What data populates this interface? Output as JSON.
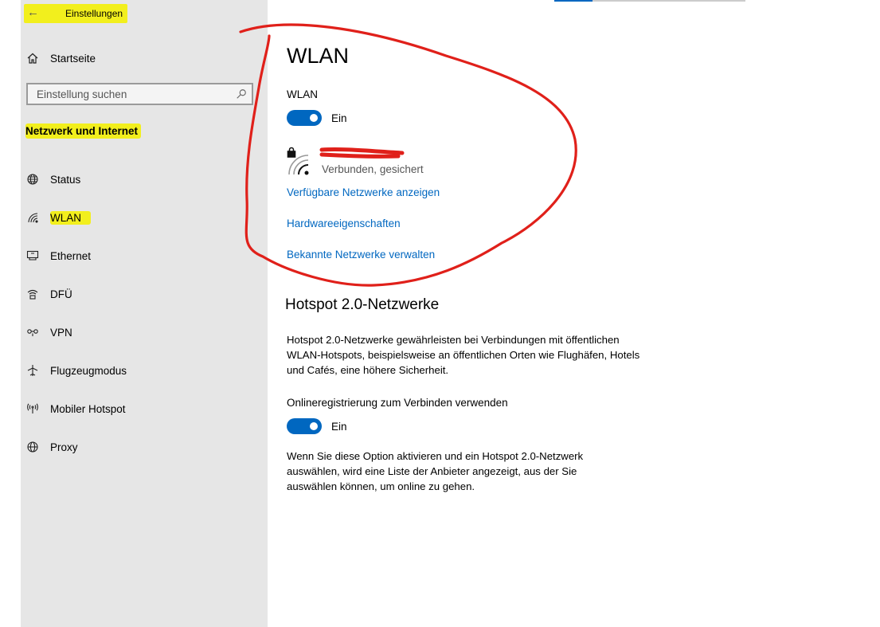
{
  "sidebar": {
    "back_title": "Einstellungen",
    "home_label": "Startseite",
    "search_placeholder": "Einstellung suchen",
    "section_title": "Netzwerk und Internet",
    "items": [
      {
        "label": "Status",
        "icon": "globe-status-icon"
      },
      {
        "label": "WLAN",
        "icon": "wifi-icon"
      },
      {
        "label": "Ethernet",
        "icon": "ethernet-icon"
      },
      {
        "label": "DFÜ",
        "icon": "dialup-icon"
      },
      {
        "label": "VPN",
        "icon": "vpn-icon"
      },
      {
        "label": "Flugzeugmodus",
        "icon": "airplane-icon"
      },
      {
        "label": "Mobiler Hotspot",
        "icon": "hotspot-icon"
      },
      {
        "label": "Proxy",
        "icon": "globe-icon"
      }
    ]
  },
  "main": {
    "page_title": "WLAN",
    "wlan_toggle_label": "WLAN",
    "wlan_toggle_state": "Ein",
    "network_status": "Verbunden, gesichert",
    "links": [
      "Verfügbare Netzwerke anzeigen",
      "Hardwareeigenschaften",
      "Bekannte Netzwerke verwalten"
    ],
    "hotspot_heading": "Hotspot 2.0-Netzwerke",
    "hotspot_description": "Hotspot 2.0-Netzwerke gewährleisten bei Verbindungen mit öffentlichen WLAN-Hotspots, beispielsweise an öffentlichen Orten wie Flughäfen, Hotels und Cafés, eine höhere Sicherheit.",
    "online_reg_label": "Onlineregistrierung zum Verbinden verwenden",
    "online_reg_state": "Ein",
    "online_reg_description": "Wenn Sie diese Option aktivieren und ein Hotspot 2.0-Netzwerk auswählen, wird eine Liste der Anbieter angezeigt, aus der Sie auswählen können, um online zu gehen."
  },
  "colors": {
    "accent": "#0067c0",
    "highlight": "#f2ef1d",
    "annotation": "#e0201a",
    "sidebar_bg": "#e6e6e6"
  }
}
